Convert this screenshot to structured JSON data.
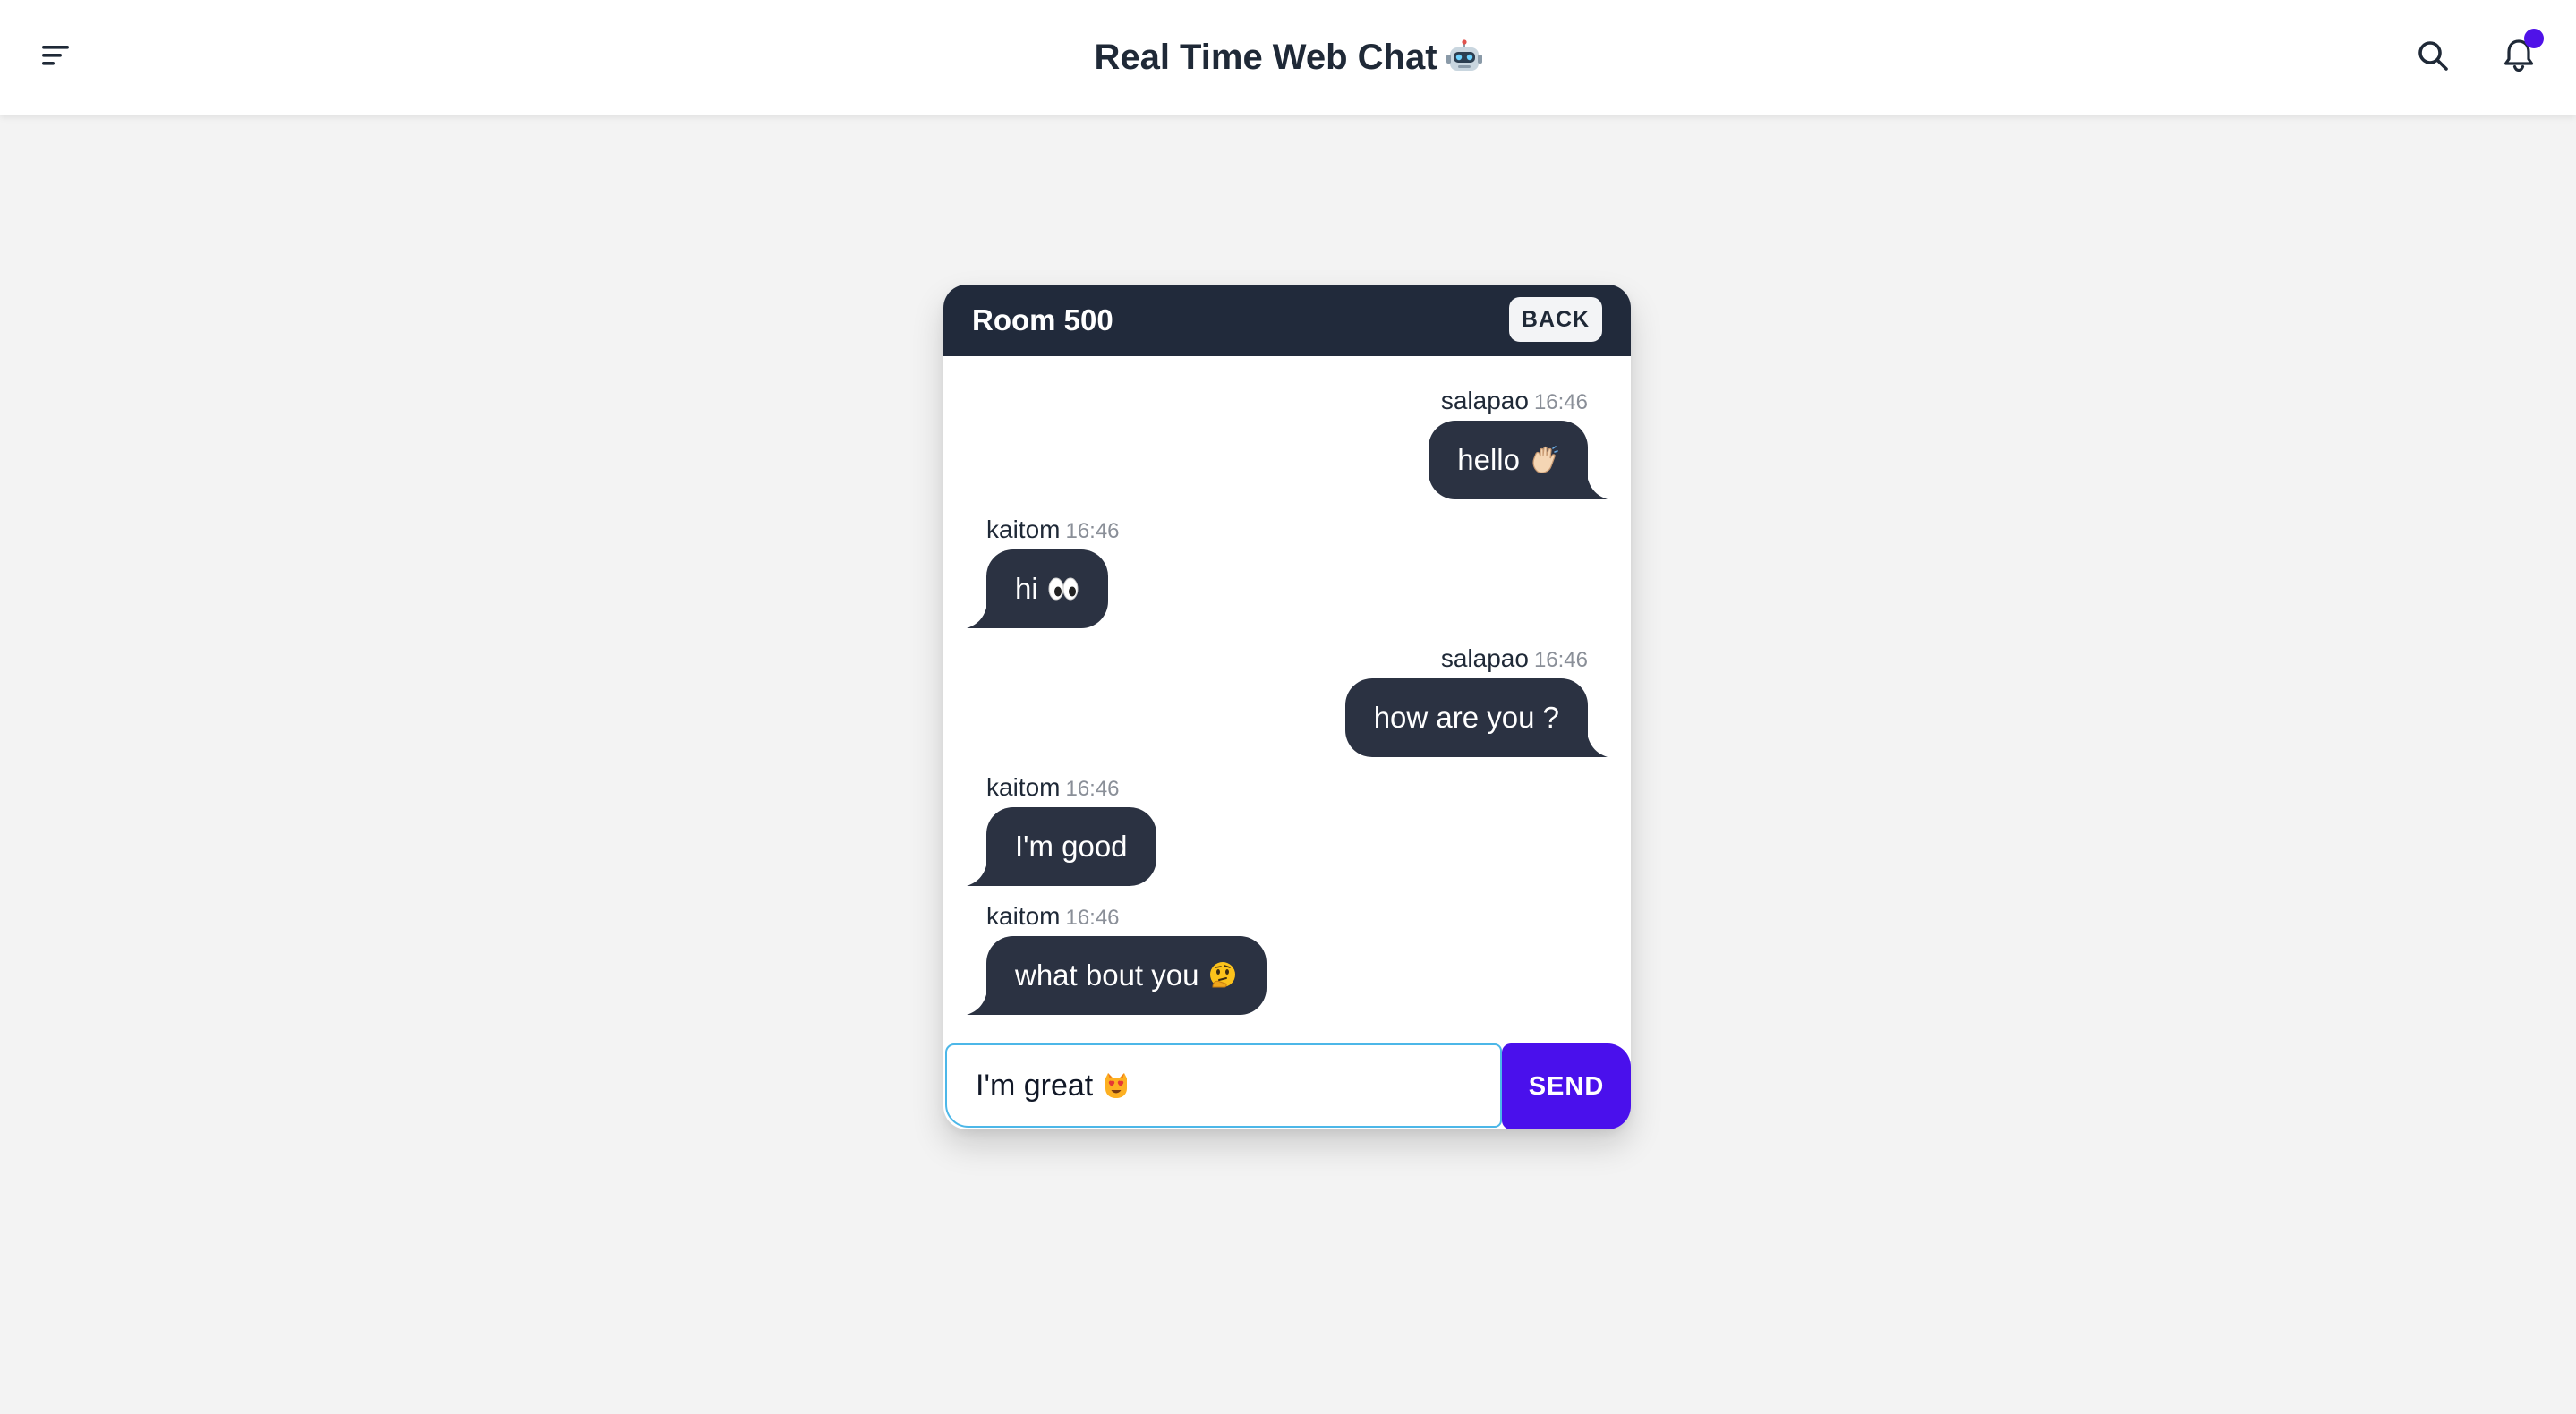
{
  "app": {
    "title": "Real Time Web Chat",
    "title_emoji_icon": "robot-emoji-icon",
    "accent_color": "#4a10ec",
    "notification_dot_color": "#4f12e8"
  },
  "navbar": {
    "menu_icon": "menu-icon",
    "search_icon": "search-icon",
    "bell_icon": "bell-icon",
    "has_unread_notifications": true
  },
  "room": {
    "name": "Room 500",
    "back_label": "BACK",
    "messages": [
      {
        "sender": "salapao",
        "time": "16:46",
        "text": "hello",
        "emoji": "waving-hand-emoji-icon",
        "direction": "outgoing"
      },
      {
        "sender": "kaitom",
        "time": "16:46",
        "text": "hi",
        "emoji": "eyes-emoji-icon",
        "direction": "incoming"
      },
      {
        "sender": "salapao",
        "time": "16:46",
        "text": "how are you ?",
        "emoji": "",
        "direction": "outgoing"
      },
      {
        "sender": "kaitom",
        "time": "16:46",
        "text": "I'm good",
        "emoji": "",
        "direction": "incoming"
      },
      {
        "sender": "kaitom",
        "time": "16:46",
        "text": "what bout you",
        "emoji": "thinking-face-emoji-icon",
        "direction": "incoming"
      }
    ]
  },
  "composer": {
    "value": "I'm great",
    "value_emoji": "heart-eyes-cat-emoji-icon",
    "send_label": "SEND"
  }
}
